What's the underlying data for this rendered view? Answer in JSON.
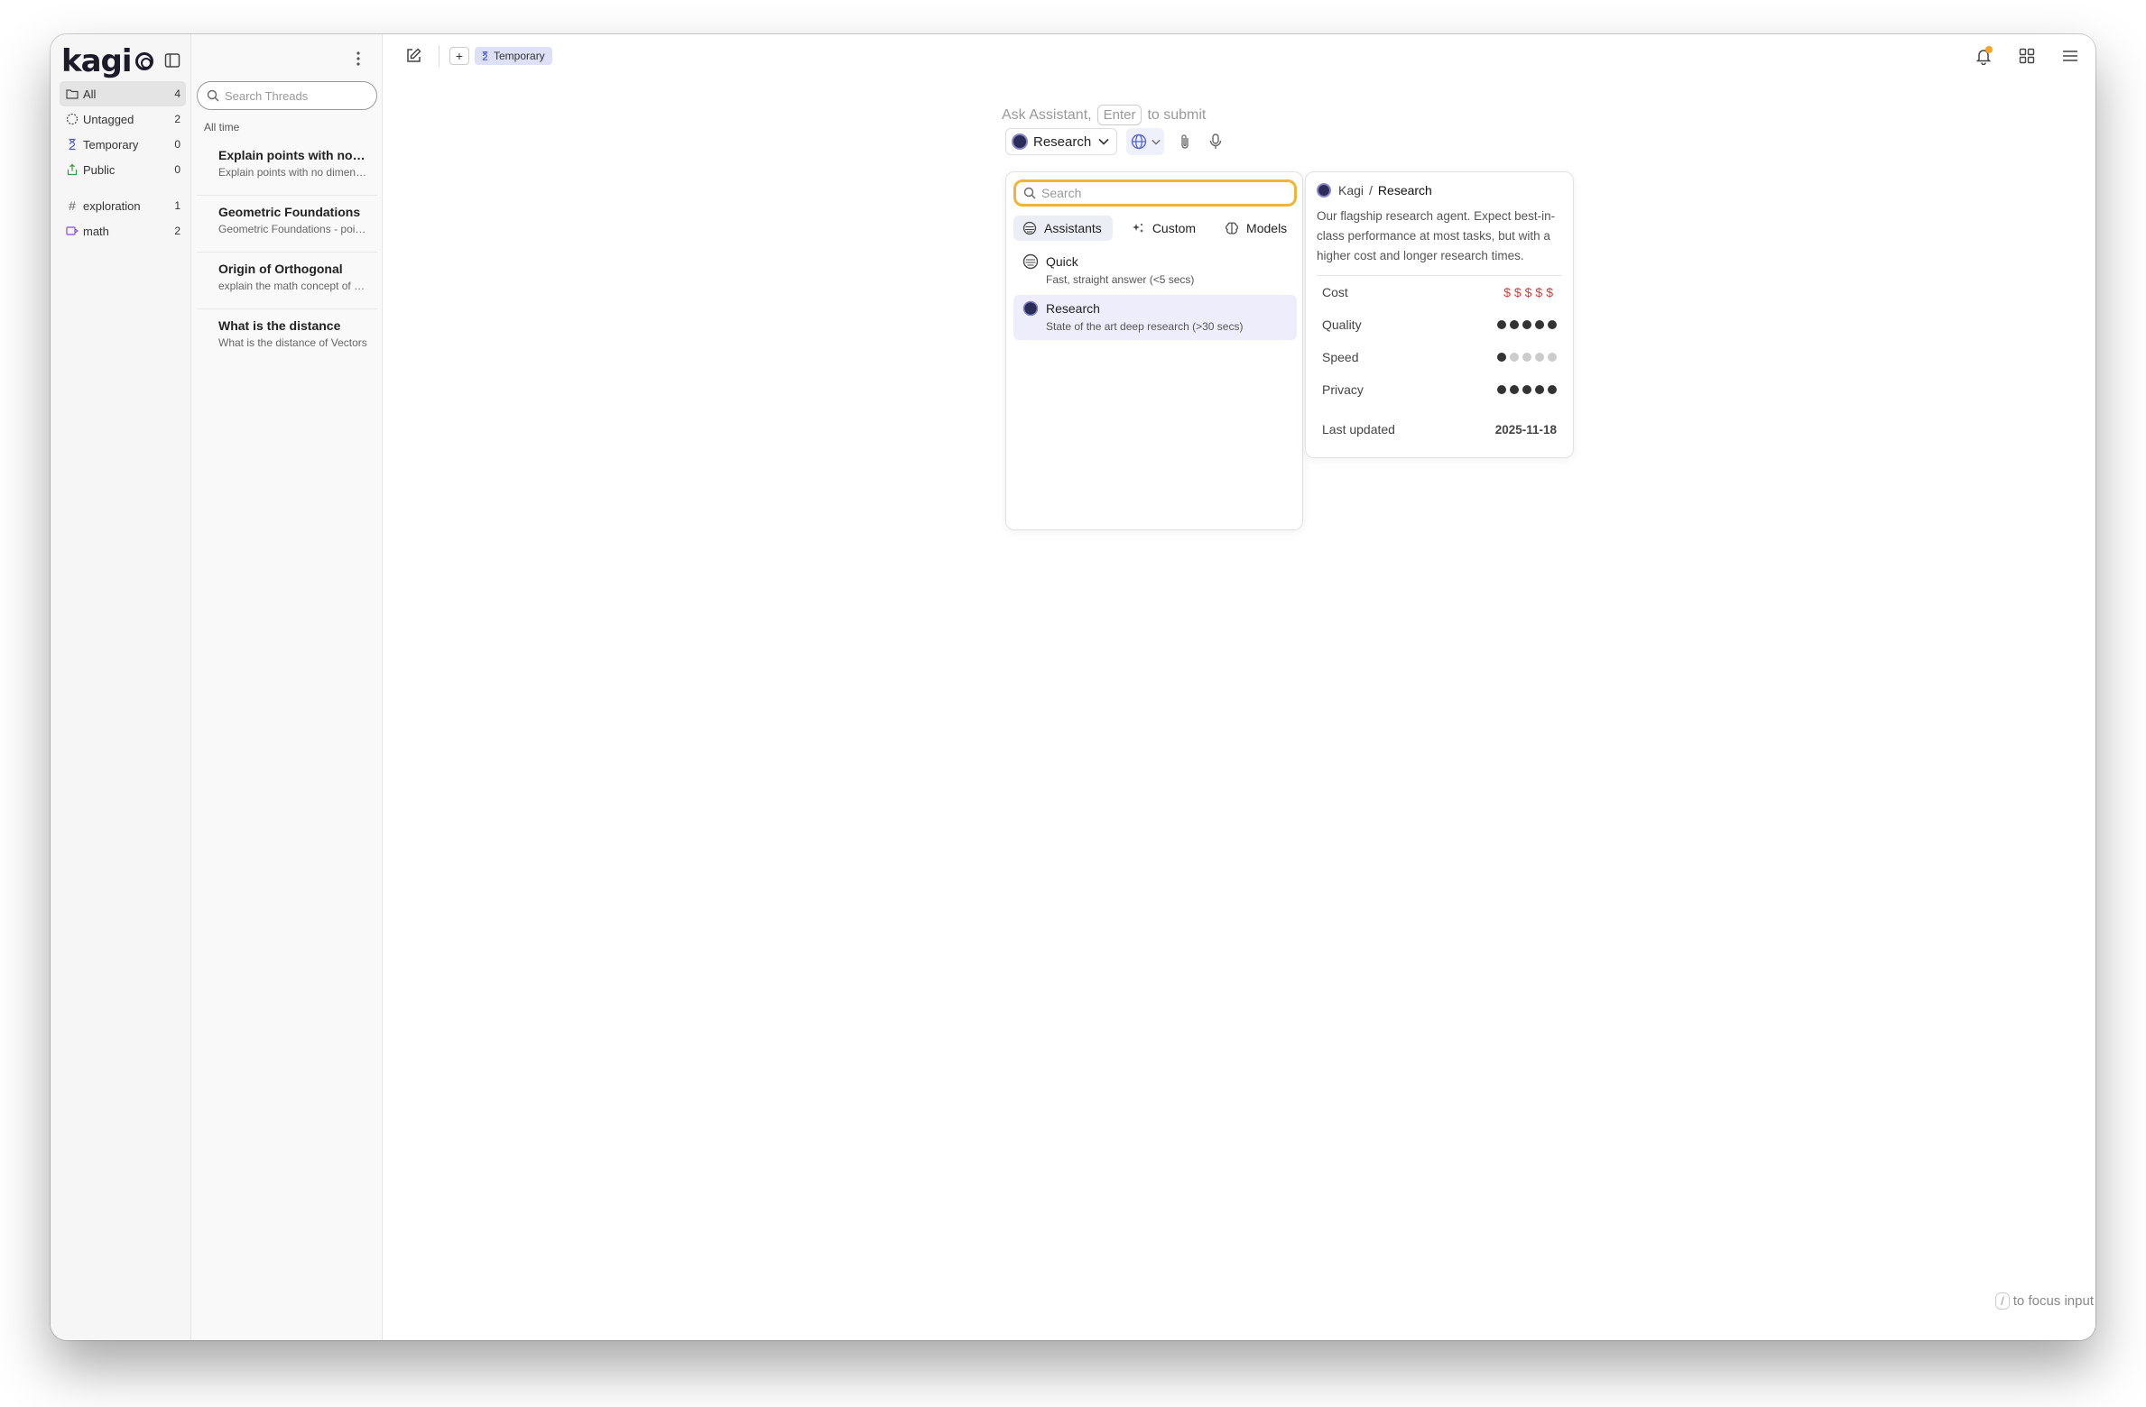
{
  "logo": {
    "text": "kagi"
  },
  "nav": {
    "items": [
      {
        "label": "All",
        "count": "4",
        "icon": "folder-icon"
      },
      {
        "label": "Untagged",
        "count": "2",
        "icon": "dashed-circle-icon"
      },
      {
        "label": "Temporary",
        "count": "0",
        "icon": "hourglass-icon"
      },
      {
        "label": "Public",
        "count": "0",
        "icon": "share-icon"
      }
    ],
    "tags": [
      {
        "label": "exploration",
        "count": "1",
        "icon": "hash-icon"
      },
      {
        "label": "math",
        "count": "2",
        "icon": "tag-icon"
      }
    ]
  },
  "threads": {
    "search_placeholder": "Search Threads",
    "section": "All time",
    "items": [
      {
        "title": "Explain points with no dimensions",
        "snippet": "Explain points with no dimensions"
      },
      {
        "title": "Geometric Foundations",
        "snippet": "Geometric Foundations - points"
      },
      {
        "title": "Origin of Orthogonal",
        "snippet": "explain the math concept of orthogonal"
      },
      {
        "title": "What is the distance",
        "snippet": "What is the distance of Vectors"
      }
    ]
  },
  "topbar": {
    "plus": "+",
    "temporary_chip": "Temporary"
  },
  "prompt": {
    "ask": "Ask Assistant,",
    "key": "Enter",
    "to_submit": "to submit"
  },
  "toolbar": {
    "model": "Research"
  },
  "dropdown": {
    "search_placeholder": "Search",
    "tabs": [
      {
        "label": "Assistants",
        "icon": "assistants-icon"
      },
      {
        "label": "Custom",
        "icon": "sparkle-icon"
      },
      {
        "label": "Models",
        "icon": "brain-icon"
      }
    ],
    "items": [
      {
        "name": "Quick",
        "desc": "Fast, straight answer (<5 secs)"
      },
      {
        "name": "Research",
        "desc": "State of the art deep research (>30 secs)"
      }
    ]
  },
  "info": {
    "vendor": "Kagi",
    "separator": "/",
    "name": "Research",
    "description": "Our flagship research agent. Expect best-in-class performance at most tasks, but with a higher cost and longer research times.",
    "cost_label": "Cost",
    "cost_value": "$$$$$",
    "quality_label": "Quality",
    "quality_level": 5,
    "speed_label": "Speed",
    "speed_level": 1,
    "privacy_label": "Privacy",
    "privacy_level": 5,
    "last_updated_label": "Last updated",
    "last_updated": "2025-11-18",
    "colors": {
      "cost": "#d93a3a",
      "accent": "#f2b437",
      "selection": "#ededfb"
    }
  },
  "footer": {
    "key": "/",
    "hint": "to focus input"
  }
}
